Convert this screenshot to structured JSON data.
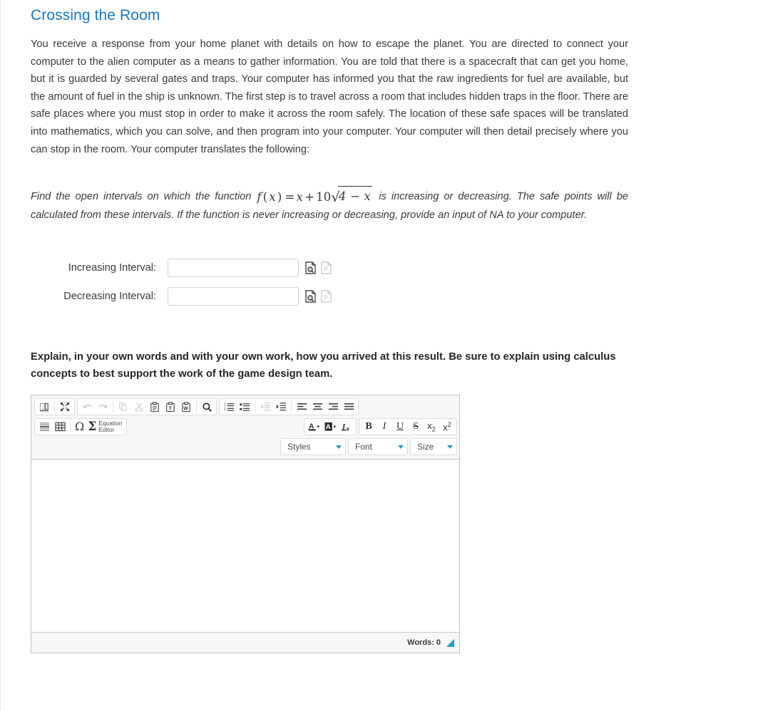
{
  "page": {
    "title": "Crossing the Room",
    "title_color": "#1b76bc",
    "intro": "You receive a response from your home planet with details on how to escape the planet. You are directed to connect your computer to the alien computer as a means to gather information. You are told that there is a spacecraft that can get you home, but it is guarded by several gates and traps. Your computer has informed you that the raw ingredients for fuel are available, but the amount of fuel in the ship is unknown. The first step is to travel across a room that includes hidden traps in the floor. There are safe places where you must stop in order to make it across the room safely. The location of these safe spaces will be translated into mathematics, which you can solve, and then program into your computer. Your computer will then detail precisely where you can stop in the room. Your computer translates the following:"
  },
  "problem": {
    "lead": "Find the open intervals on which the function",
    "math": {
      "fn_name": "f",
      "fn_arg": "x",
      "equals": "=",
      "term1": "x",
      "plus": "+",
      "coefficient": "10",
      "radicand": "4 − x",
      "plain": "f (x) = x + 10√(4 − x)"
    },
    "tail": "is increasing or decreasing. The safe points will be calculated from these intervals. If the function is never increasing or decreasing, provide an input of NA to your computer."
  },
  "answers": [
    {
      "label": "Increasing Interval:",
      "value": "",
      "placeholder": "",
      "preview_icon": "document-magnify-icon",
      "secondary_icon": "document-preview-disabled-icon"
    },
    {
      "label": "Decreasing Interval:",
      "value": "",
      "placeholder": "",
      "preview_icon": "document-magnify-icon",
      "secondary_icon": "document-preview-disabled-icon"
    }
  ],
  "explain_prompt": "Explain, in your own words and with your own work, how you arrived at this result. Be sure to explain using calculus concepts to best support the work of the game design team.",
  "editor": {
    "toolbar_row1": [
      {
        "group": "document",
        "buttons": [
          {
            "name": "templates-icon",
            "label": "",
            "disabled": false
          },
          {
            "name": "maximize-icon",
            "label": "",
            "disabled": false
          }
        ]
      },
      {
        "group": "clipboard",
        "buttons": [
          {
            "name": "undo-icon",
            "label": "",
            "disabled": true
          },
          {
            "name": "redo-icon",
            "label": "",
            "disabled": true
          },
          {
            "name": "copy-icon",
            "label": "",
            "disabled": true
          },
          {
            "name": "cut-icon",
            "label": "",
            "disabled": true
          },
          {
            "name": "paste-icon",
            "label": "",
            "disabled": false
          },
          {
            "name": "paste-as-text-icon",
            "label": "",
            "disabled": false
          },
          {
            "name": "paste-from-word-icon",
            "label": "",
            "disabled": false
          },
          {
            "name": "find-icon",
            "label": "",
            "disabled": false
          }
        ]
      },
      {
        "group": "paragraph",
        "buttons": [
          {
            "name": "numbered-list-icon",
            "label": "",
            "disabled": false
          },
          {
            "name": "bulleted-list-icon",
            "label": "",
            "disabled": false
          },
          {
            "name": "outdent-icon",
            "label": "",
            "disabled": true
          },
          {
            "name": "indent-icon",
            "label": "",
            "disabled": false
          },
          {
            "name": "align-left-icon",
            "label": "",
            "disabled": false
          },
          {
            "name": "align-center-icon",
            "label": "",
            "disabled": false
          },
          {
            "name": "align-right-icon",
            "label": "",
            "disabled": false
          },
          {
            "name": "align-justify-icon",
            "label": "",
            "disabled": false
          }
        ]
      }
    ],
    "toolbar_row2": {
      "insert_buttons": [
        {
          "name": "horizontal-rule-icon"
        },
        {
          "name": "table-icon"
        }
      ],
      "special_char_label": "Ω",
      "equation_editor_line1": "Equation",
      "equation_editor_line2": "Editor",
      "colors": [
        {
          "name": "text-color-icon",
          "label": "A"
        },
        {
          "name": "background-color-icon",
          "label": "A"
        },
        {
          "name": "remove-format-icon",
          "label": "I"
        }
      ],
      "basic_styles": [
        {
          "name": "bold-button",
          "label": "B"
        },
        {
          "name": "italic-button",
          "label": "I"
        },
        {
          "name": "underline-button",
          "label": "U"
        },
        {
          "name": "strike-button",
          "label": "S"
        },
        {
          "name": "subscript-button",
          "label": "x"
        },
        {
          "name": "superscript-button",
          "label": "x"
        }
      ]
    },
    "dropdowns": [
      {
        "name": "styles-dropdown",
        "label": "Styles"
      },
      {
        "name": "font-dropdown",
        "label": "Font"
      },
      {
        "name": "size-dropdown",
        "label": "Size"
      }
    ],
    "content": "",
    "word_count_label": "Words: 0",
    "accent_color": "#1f9fc4"
  }
}
